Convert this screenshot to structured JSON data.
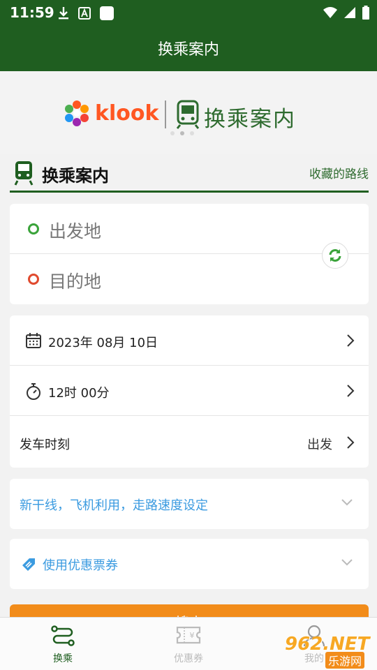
{
  "status_bar": {
    "time": "11:59",
    "icons": [
      "download-icon",
      "font-icon",
      "blank-square-icon",
      "wifi-icon",
      "signal-icon",
      "battery-icon"
    ]
  },
  "app_bar": {
    "title": "换乘案内"
  },
  "banner": {
    "partner_logo_text": "klook",
    "brand_text": "换乘案内",
    "dots": 3,
    "active_dot": 2
  },
  "section": {
    "title": "换乘案内",
    "link": "收藏的路线"
  },
  "route": {
    "origin_placeholder": "出发地",
    "destination_placeholder": "目的地"
  },
  "options": {
    "date": "2023年 08月 10日",
    "time": "12时 00分",
    "departure_label": "发车时刻",
    "departure_value": "出发"
  },
  "express": {
    "label": "新干线，飞机利用，走路速度设定"
  },
  "coupon": {
    "label": "使用优惠票券"
  },
  "search_button": {
    "label": "搜索"
  },
  "bottom_nav": [
    {
      "label": "换乘",
      "icon": "route-icon"
    },
    {
      "label": "优惠券",
      "icon": "ticket-icon"
    },
    {
      "label": "我的",
      "icon": "person-icon"
    }
  ],
  "watermark": {
    "main": "962.NET",
    "sub": "乐游网"
  },
  "colors": {
    "primary": "#1f5e20",
    "accent_orange": "#f28c1a",
    "link_blue": "#3b9be0",
    "origin_green": "#3aa33a",
    "destination_red": "#e04a2e"
  }
}
